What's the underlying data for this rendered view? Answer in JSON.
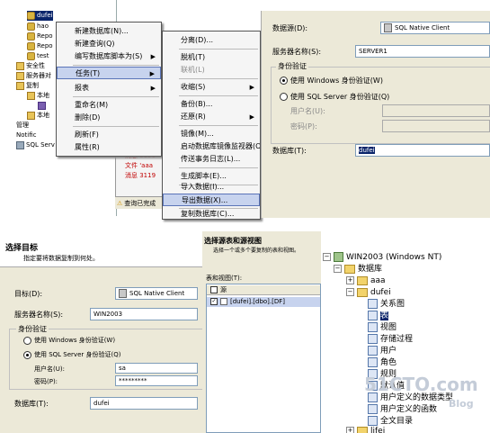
{
  "tree_top": {
    "items": [
      "dufei",
      "hao",
      "Repo",
      "Repo",
      "test",
      "安全性",
      "服务器对",
      "复制",
      "本地",
      "",
      "本地",
      "管理",
      "Notific",
      "SQL Serv"
    ]
  },
  "messages": [
    "消息 3156",
    "文件 'aaa",
    "消息 3119",
    "查询已完成"
  ],
  "context_menu": {
    "items": [
      "新建数据库(N)...",
      "新建查询(Q)",
      "编写数据库脚本为(S)",
      "任务(T)",
      "报表",
      "重命名(M)",
      "删除(D)",
      "刷新(F)",
      "属性(R)"
    ]
  },
  "tasks_submenu": {
    "items": [
      "分离(D)...",
      "脱机(T)",
      "联机(L)",
      "收缩(S)",
      "备份(B)...",
      "还原(R)",
      "镜像(M)...",
      "启动数据库镜像监视器(O)",
      "传送事务日志(L)...",
      "生成脚本(E)...",
      "导入数据(I)...",
      "导出数据(X)...",
      "复制数据库(C)..."
    ]
  },
  "dialog_source": {
    "datasource_label": "数据源(D):",
    "datasource_value": "SQL Native Client",
    "server_label": "服务器名称(S):",
    "server_value": "SERVER1",
    "auth_group": "身份验证",
    "auth_windows": "使用 Windows 身份验证(W)",
    "auth_sql": "使用 SQL Server 身份验证(Q)",
    "username_label": "用户名(U):",
    "password_label": "密码(P):",
    "database_label": "数据库(T):",
    "database_value": "dufei"
  },
  "dialog_target": {
    "title": "选择目标",
    "subtitle": "指定要将数据复制到何处。",
    "target_label": "目标(D):",
    "target_value": "SQL Native Client",
    "server_label": "服务器名称(S):",
    "server_value": "WIN2003",
    "auth_group": "身份验证",
    "auth_windows": "使用 Windows 身份验证(W)",
    "auth_sql": "使用 SQL Server 身份验证(Q)",
    "username_label": "用户名(U):",
    "username_value": "sa",
    "password_label": "密码(P):",
    "password_value": "*********",
    "database_label": "数据库(T):",
    "database_value": "dufei"
  },
  "dialog_tables": {
    "title": "选择源表和源视图",
    "subtitle": "选择一个或多个要复制的表和视图。",
    "list_label": "表和视图(T):",
    "col_header": "源",
    "rows": [
      "[dufei].[dbo].[DF]"
    ]
  },
  "tree_br": {
    "server": "WIN2003 (Windows NT)",
    "databases": "数据库",
    "db_aaa": "aaa",
    "db_dufei": "dufei",
    "nodes": [
      "关系图",
      "表",
      "视图",
      "存储过程",
      "用户",
      "角色",
      "规则",
      "默认值",
      "用户定义的数据类型",
      "用户定义的函数",
      "全文目录"
    ],
    "db_last": "lifei"
  },
  "watermark": {
    "site": "51CTO.com",
    "blog": "Blog"
  },
  "colors": {
    "selection": "#0a246a",
    "menu_highlight": "#c7d3ee",
    "dialog_bg": "#ece9d8"
  }
}
